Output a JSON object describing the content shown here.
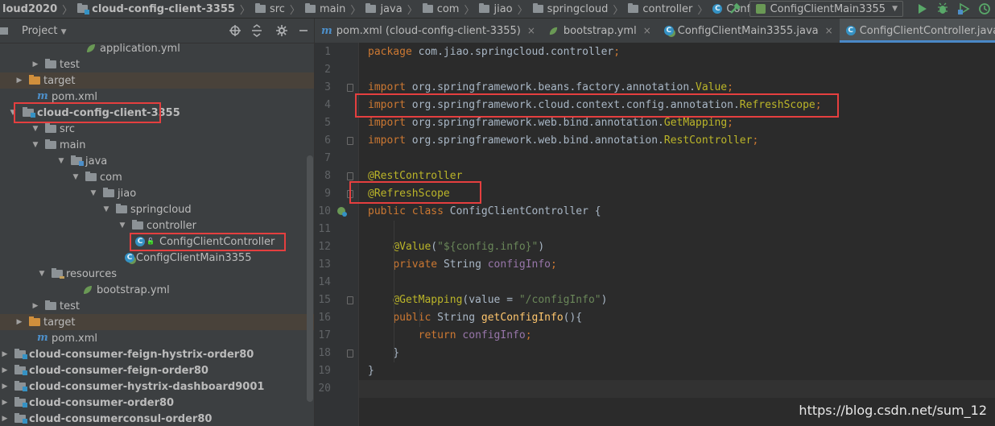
{
  "nav": {
    "crumbs": [
      {
        "label": "loud2020",
        "bold": true,
        "icon": "folder-icon"
      },
      {
        "label": "cloud-config-client-3355",
        "bold": true,
        "icon": "module-folder-icon"
      },
      {
        "label": "src",
        "bold": false,
        "icon": "folder-icon"
      },
      {
        "label": "main",
        "bold": false,
        "icon": "folder-icon"
      },
      {
        "label": "java",
        "bold": false,
        "icon": "source-folder-icon"
      },
      {
        "label": "com",
        "bold": false,
        "icon": "package-icon"
      },
      {
        "label": "jiao",
        "bold": false,
        "icon": "package-icon"
      },
      {
        "label": "springcloud",
        "bold": false,
        "icon": "package-icon"
      },
      {
        "label": "controller",
        "bold": false,
        "icon": "package-icon"
      },
      {
        "label": "ConfigClientController",
        "bold": false,
        "icon": "class-icon"
      }
    ],
    "run_config": "ConfigClientMain3355",
    "toolbar_icons": [
      "hammer-icon",
      "run-icon",
      "debug-icon",
      "coverage-icon",
      "profile-icon"
    ]
  },
  "project_panel": {
    "title": "Project",
    "header_icons": [
      "target-icon",
      "collapse-icon",
      "settings-icon",
      "minimize-icon"
    ]
  },
  "tree": [
    {
      "label": "application.yml",
      "icon": "spring-leaf-icon",
      "arrow": "none",
      "bold": false,
      "excluded": false
    },
    {
      "label": "test",
      "icon": "folder-icon",
      "arrow": "right",
      "bold": false,
      "excluded": false
    },
    {
      "label": "target",
      "icon": "excluded-folder-icon",
      "arrow": "right",
      "bold": false,
      "excluded": true
    },
    {
      "label": "pom.xml",
      "icon": "maven-icon",
      "arrow": "none",
      "bold": false,
      "excluded": false
    },
    {
      "label": "cloud-config-client-3355",
      "icon": "module-folder-icon",
      "arrow": "down",
      "bold": true,
      "excluded": false
    },
    {
      "label": "src",
      "icon": "folder-icon",
      "arrow": "down",
      "bold": false,
      "excluded": false
    },
    {
      "label": "main",
      "icon": "folder-icon",
      "arrow": "down",
      "bold": false,
      "excluded": false
    },
    {
      "label": "java",
      "icon": "source-folder-icon",
      "arrow": "down",
      "bold": false,
      "excluded": false
    },
    {
      "label": "com",
      "icon": "package-icon",
      "arrow": "down",
      "bold": false,
      "excluded": false
    },
    {
      "label": "jiao",
      "icon": "package-icon",
      "arrow": "down",
      "bold": false,
      "excluded": false
    },
    {
      "label": "springcloud",
      "icon": "package-icon",
      "arrow": "down",
      "bold": false,
      "excluded": false
    },
    {
      "label": "controller",
      "icon": "package-icon",
      "arrow": "down",
      "bold": false,
      "excluded": false
    },
    {
      "label": "ConfigClientController",
      "icon": "class-icon",
      "arrow": "none",
      "bold": false,
      "excluded": false
    },
    {
      "label": "ConfigClientMain3355",
      "icon": "spring-boot-class-icon",
      "arrow": "none",
      "bold": false,
      "excluded": false
    },
    {
      "label": "resources",
      "icon": "resources-folder-icon",
      "arrow": "down",
      "bold": false,
      "excluded": false
    },
    {
      "label": "bootstrap.yml",
      "icon": "spring-leaf-icon",
      "arrow": "none",
      "bold": false,
      "excluded": false
    },
    {
      "label": "test",
      "icon": "folder-icon",
      "arrow": "right",
      "bold": false,
      "excluded": false
    },
    {
      "label": "target",
      "icon": "excluded-folder-icon",
      "arrow": "right",
      "bold": false,
      "excluded": true
    },
    {
      "label": "pom.xml",
      "icon": "maven-icon",
      "arrow": "none",
      "bold": false,
      "excluded": false
    },
    {
      "label": "cloud-consumer-feign-hystrix-order80",
      "icon": "module-folder-icon",
      "arrow": "right",
      "bold": true,
      "excluded": false
    },
    {
      "label": "cloud-consumer-feign-order80",
      "icon": "module-folder-icon",
      "arrow": "right",
      "bold": true,
      "excluded": false
    },
    {
      "label": "cloud-consumer-hystrix-dashboard9001",
      "icon": "module-folder-icon",
      "arrow": "right",
      "bold": true,
      "excluded": false
    },
    {
      "label": "cloud-consumer-order80",
      "icon": "module-folder-icon",
      "arrow": "right",
      "bold": true,
      "excluded": false
    },
    {
      "label": "cloud-consumerconsul-order80",
      "icon": "module-folder-icon",
      "arrow": "right",
      "bold": true,
      "excluded": false
    }
  ],
  "tabs": [
    {
      "label": "pom.xml (cloud-config-client-3355)",
      "icon": "maven-icon",
      "active": false
    },
    {
      "label": "bootstrap.yml",
      "icon": "spring-leaf-icon",
      "active": false
    },
    {
      "label": "ConfigClientMain3355.java",
      "icon": "spring-boot-class-icon",
      "active": false
    },
    {
      "label": "ConfigClientController.java",
      "icon": "class-icon",
      "active": true
    }
  ],
  "code": {
    "lines": [
      [
        [
          "k",
          "package "
        ],
        [
          "pl",
          "com.jiao.springcloud.controller"
        ],
        [
          "k",
          ";"
        ]
      ],
      [],
      [
        [
          "k",
          "import "
        ],
        [
          "pl",
          "org.springframework.beans.factory.annotation."
        ],
        [
          "a",
          "Value"
        ],
        [
          "k",
          ";"
        ]
      ],
      [
        [
          "k",
          "import "
        ],
        [
          "pl",
          "org.springframework.cloud.context.config.annotation."
        ],
        [
          "a",
          "RefreshScope"
        ],
        [
          "k",
          ";"
        ]
      ],
      [
        [
          "k",
          "import "
        ],
        [
          "pl",
          "org.springframework.web.bind.annotation."
        ],
        [
          "a",
          "GetMapping"
        ],
        [
          "k",
          ";"
        ]
      ],
      [
        [
          "k",
          "import "
        ],
        [
          "pl",
          "org.springframework.web.bind.annotation."
        ],
        [
          "a",
          "RestController"
        ],
        [
          "k",
          ";"
        ]
      ],
      [],
      [
        [
          "a",
          "@RestController"
        ]
      ],
      [
        [
          "a",
          "@RefreshScope"
        ]
      ],
      [
        [
          "k",
          "public class "
        ],
        [
          "pl",
          "ConfigClientController {"
        ]
      ],
      [],
      [
        [
          "pl",
          "    "
        ],
        [
          "a",
          "@Value"
        ],
        [
          "pl",
          "("
        ],
        [
          "s",
          "\"${config.info}\""
        ],
        [
          "pl",
          ")"
        ]
      ],
      [
        [
          "pl",
          "    "
        ],
        [
          "k",
          "private "
        ],
        [
          "pl",
          "String "
        ],
        [
          "f",
          "configInfo"
        ],
        [
          "k",
          ";"
        ]
      ],
      [],
      [
        [
          "pl",
          "    "
        ],
        [
          "a",
          "@GetMapping"
        ],
        [
          "pl",
          "("
        ],
        [
          "pl",
          "value = "
        ],
        [
          "s",
          "\"/configInfo\""
        ],
        [
          "pl",
          ")"
        ]
      ],
      [
        [
          "pl",
          "    "
        ],
        [
          "k",
          "public "
        ],
        [
          "pl",
          "String "
        ],
        [
          "m",
          "getConfigInfo"
        ],
        [
          "pl",
          "(){"
        ]
      ],
      [
        [
          "pl",
          "        "
        ],
        [
          "k",
          "return "
        ],
        [
          "f",
          "configInfo"
        ],
        [
          "k",
          ";"
        ]
      ],
      [
        [
          "pl",
          "    }"
        ]
      ],
      [
        [
          "pl",
          "}"
        ]
      ],
      []
    ],
    "current_line": 20
  },
  "watermark": "https://blog.csdn.net/sum_12"
}
